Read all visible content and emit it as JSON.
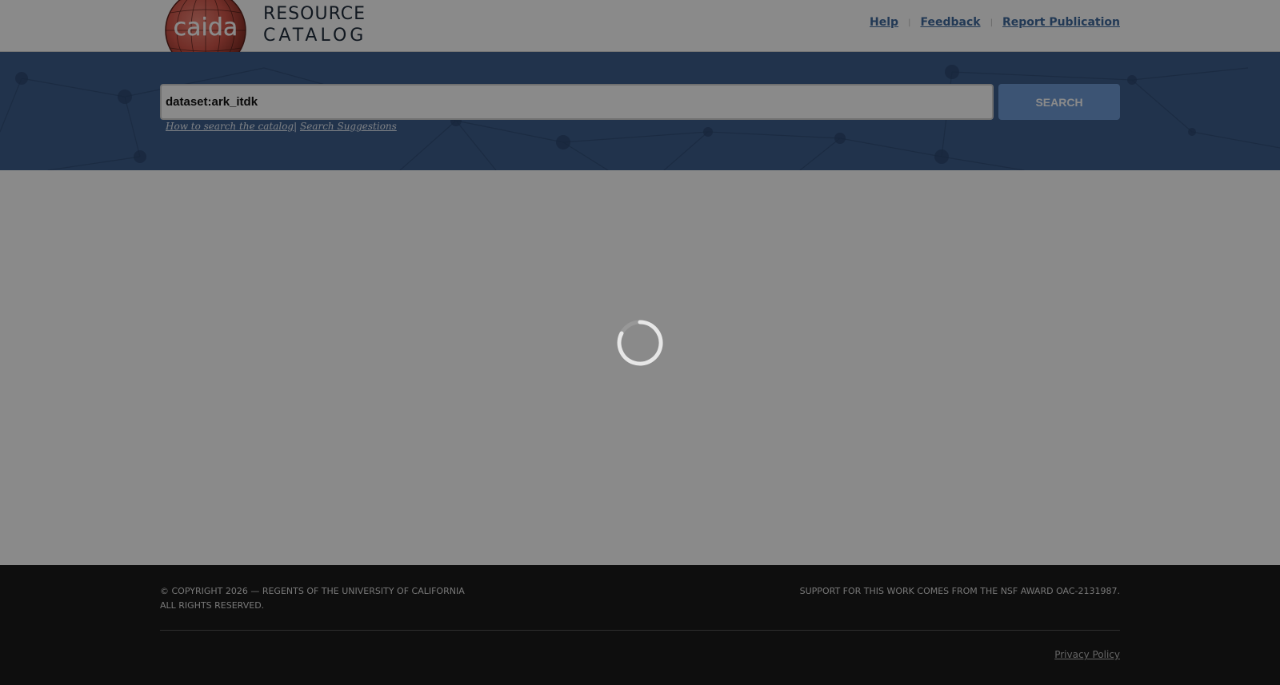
{
  "header": {
    "logo_text": "caida",
    "title_line1": "RESOURCE",
    "title_line2": "CATALOG",
    "links": {
      "help": "Help",
      "feedback": "Feedback",
      "report_publication": "Report Publication"
    },
    "separator": "|"
  },
  "search": {
    "query_value": "dataset:ark_itdk",
    "button_label": "SEARCH",
    "help_link": "How to search the catalog",
    "help_separator": "|",
    "suggestions_link": "Search Suggestions"
  },
  "main": {
    "loading": true
  },
  "footer": {
    "copyright_line1": "© Copyright 2026 — Regents of the University of California",
    "copyright_line2": "All rights reserved.",
    "award": "Support for this work comes from the NSF Award OAC-2131987.",
    "privacy_link": "Privacy Policy"
  },
  "colors": {
    "header_bg": "#ffffff",
    "band_bg": "#3d5e8c",
    "link": "#3f6a9e",
    "search_button": "#6f9bd6",
    "footer_bg": "#1a1a1a",
    "overlay": "rgba(0,0,0,0.46)"
  },
  "icons": {
    "logo": "caida-globe-logo",
    "spinner": "loading-spinner-icon"
  }
}
